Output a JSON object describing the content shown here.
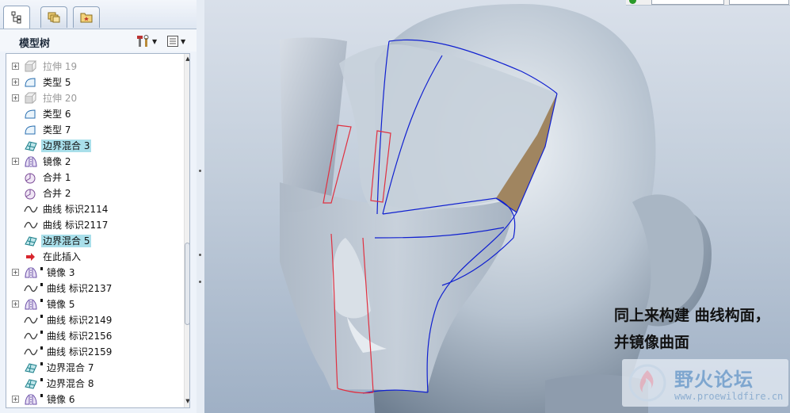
{
  "panel": {
    "title": "模型树",
    "tabs": [
      "model-tree-tab",
      "layers-tab",
      "favorites-tab"
    ]
  },
  "tree": {
    "items": [
      {
        "label": "拉伸 19",
        "icon": "extrude-icon",
        "expand": true,
        "dim": true
      },
      {
        "label": "类型 5",
        "icon": "surface-icon",
        "expand": true
      },
      {
        "label": "拉伸 20",
        "icon": "extrude-icon",
        "expand": true,
        "dim": true
      },
      {
        "label": "类型 6",
        "icon": "surface-icon"
      },
      {
        "label": "类型 7",
        "icon": "surface-icon"
      },
      {
        "label": "边界混合 3",
        "icon": "boundary-blend-icon",
        "selected": true
      },
      {
        "label": "镜像 2",
        "icon": "mirror-icon",
        "expand": true
      },
      {
        "label": "合并 1",
        "icon": "merge-icon"
      },
      {
        "label": "合并 2",
        "icon": "merge-icon"
      },
      {
        "label": "曲线 标识2114",
        "icon": "curve-icon"
      },
      {
        "label": "曲线 标识2117",
        "icon": "curve-icon"
      },
      {
        "label": "边界混合 5",
        "icon": "boundary-blend-icon",
        "selected": true
      },
      {
        "label": "在此插入",
        "icon": "insert-arrow-icon"
      },
      {
        "label": "镜像 3",
        "icon": "mirror-icon",
        "expand": true,
        "marked": true
      },
      {
        "label": "曲线 标识2137",
        "icon": "curve-icon",
        "marked": true
      },
      {
        "label": "镜像 5",
        "icon": "mirror-icon",
        "expand": true,
        "marked": true
      },
      {
        "label": "曲线 标识2149",
        "icon": "curve-icon",
        "marked": true
      },
      {
        "label": "曲线 标识2156",
        "icon": "curve-icon",
        "marked": true
      },
      {
        "label": "曲线 标识2159",
        "icon": "curve-icon",
        "marked": true
      },
      {
        "label": "边界混合 7",
        "icon": "boundary-blend-icon",
        "marked": true
      },
      {
        "label": "边界混合 8",
        "icon": "boundary-blend-icon",
        "marked": true
      },
      {
        "label": "镜像 6",
        "icon": "mirror-icon",
        "expand": true,
        "marked": true
      }
    ]
  },
  "viewport": {
    "caption_line1": "同上来构建 曲线构面，",
    "caption_line2": "并镜像曲面",
    "watermark_name": "野火论坛",
    "watermark_url": "www.proewildfire.cn"
  },
  "colors": {
    "selection": "#a9dfea",
    "surface": "#b8c6d6",
    "blue_curve": "#1020d0",
    "red_curve": "#e03040",
    "brown_patch": "#a08560",
    "watermark": "#7ea6cf"
  }
}
